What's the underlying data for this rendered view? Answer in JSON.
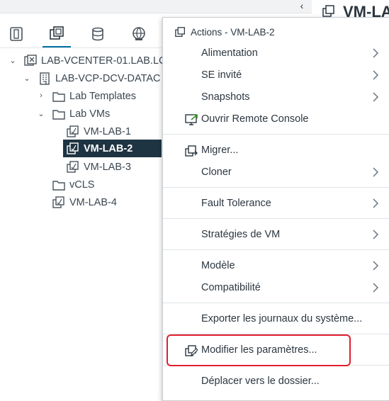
{
  "header": {
    "collapse_glyph": "‹",
    "right_title": "VM-LA"
  },
  "navigator": {
    "tabs": [
      {
        "name": "hosts-and-clusters",
        "icon": "hosts-clusters-icon"
      },
      {
        "name": "vms-and-templates",
        "icon": "vms-templates-icon",
        "active": true
      },
      {
        "name": "storage",
        "icon": "storage-icon"
      },
      {
        "name": "networking",
        "icon": "network-icon"
      }
    ],
    "tree": {
      "vcenter": "LAB-VCENTER-01.LAB.LC",
      "datacenter": "LAB-VCP-DCV-DATAC",
      "folder_templates": "Lab Templates",
      "folder_vms": "Lab VMs",
      "vm1": "VM-LAB-1",
      "vm2": "VM-LAB-2",
      "vm3": "VM-LAB-3",
      "folder_vcls": "vCLS",
      "vm4": "VM-LAB-4"
    }
  },
  "menu": {
    "title": "Actions - VM-LAB-2",
    "alimentation": "Alimentation",
    "se_invite": "SE invité",
    "snapshots": "Snapshots",
    "remote_console": "Ouvrir Remote Console",
    "migrer": "Migrer...",
    "cloner": "Cloner",
    "fault_tolerance": "Fault Tolerance",
    "strategies": "Stratégies de VM",
    "modele": "Modèle",
    "compatibilite": "Compatibilité",
    "exporter": "Exporter les journaux du système...",
    "modifier": "Modifier les paramètres...",
    "deplacer": "Déplacer vers le dossier..."
  },
  "colors": {
    "selected_row": "#1f3442",
    "active_tab": "#0072a3",
    "highlight": "#e0202f"
  }
}
